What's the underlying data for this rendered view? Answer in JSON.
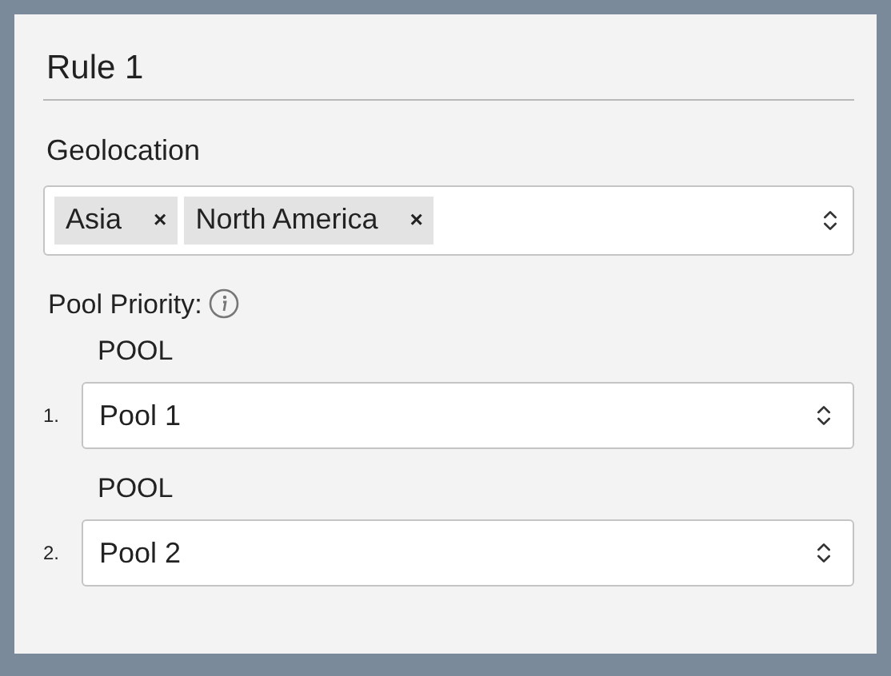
{
  "title": "Rule 1",
  "geolocation": {
    "label": "Geolocation",
    "tags": [
      {
        "label": "Asia",
        "remove": "×"
      },
      {
        "label": "North America",
        "remove": "×"
      }
    ]
  },
  "pool_priority": {
    "label": "Pool Priority:",
    "pools": [
      {
        "number": "1.",
        "label": "POOL",
        "value": "Pool 1"
      },
      {
        "number": "2.",
        "label": "POOL",
        "value": "Pool 2"
      }
    ]
  }
}
